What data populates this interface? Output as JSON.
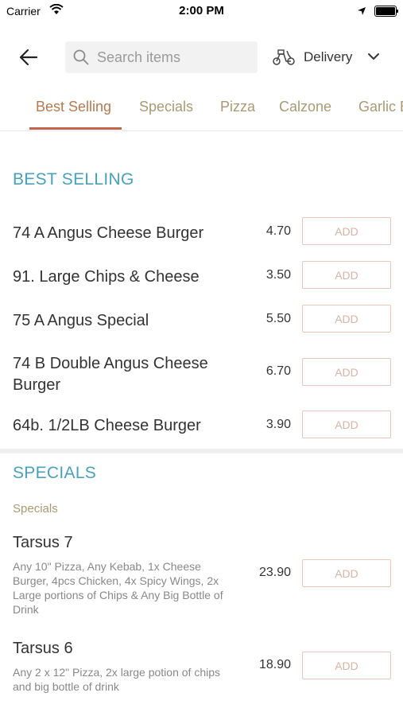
{
  "status_bar": {
    "carrier": "Carrier",
    "time": "2:00 PM"
  },
  "header": {
    "search_placeholder": "Search items",
    "delivery_label": "Delivery"
  },
  "tabs": [
    "Best Selling",
    "Specials",
    "Pizza",
    "Calzone",
    "Garlic B"
  ],
  "sections": {
    "best_selling": {
      "title": "BEST SELLING",
      "items": [
        {
          "name": "74 A Angus Cheese Burger",
          "price": "4.70",
          "add": "ADD"
        },
        {
          "name": "91. Large Chips & Cheese",
          "price": "3.50",
          "add": "ADD"
        },
        {
          "name": "75 A Angus Special",
          "price": "5.50",
          "add": "ADD"
        },
        {
          "name": "74 B Double Angus Cheese Burger",
          "price": "6.70",
          "add": "ADD"
        },
        {
          "name": "64b. 1/2LB Cheese Burger",
          "price": "3.90",
          "add": "ADD"
        }
      ]
    },
    "specials": {
      "title": "SPECIALS",
      "subtitle": "Specials",
      "items": [
        {
          "name": "Tarsus 7",
          "desc": "Any 10\" Pizza, Any Kebab, 1x Cheese Burger, 4pcs Chicken, 4x Spicy Wings, 2x Large portions of Chips & Any Big Bottle of Drink",
          "price": "23.90",
          "add": "ADD"
        },
        {
          "name": "Tarsus 6",
          "desc": "Any 2 x 12\" Pizza, 2x large potion of chips and big bottle of drink",
          "price": "18.90",
          "add": "ADD"
        }
      ]
    }
  },
  "colors": {
    "accent_teal": "#4aa0b8",
    "tab_text": "#a89a74",
    "tab_active_underline": "#c0644a",
    "add_border": "#e8c8bd"
  }
}
